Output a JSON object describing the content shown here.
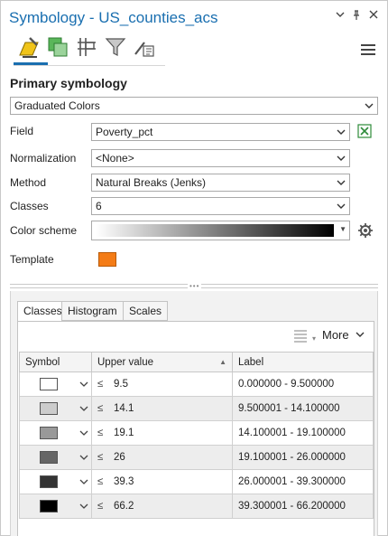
{
  "window": {
    "title": "Symbology - US_counties_acs",
    "controls": [
      "▾",
      "ᵖ",
      "×"
    ]
  },
  "toolbar": {
    "icons": [
      "primary-symbology-icon",
      "vary-symbology-icon",
      "symbol-layers-icon",
      "filter-icon",
      "label-classes-icon"
    ],
    "active_color": "#1a6fb0"
  },
  "primary": {
    "heading": "Primary symbology",
    "method_type": "Graduated Colors"
  },
  "fields": {
    "field_label": "Field",
    "field_value": "Poverty_pct",
    "normalization_label": "Normalization",
    "normalization_value": "<None>",
    "method_label": "Method",
    "method_value": "Natural Breaks (Jenks)",
    "classes_label": "Classes",
    "classes_value": "6",
    "color_scheme_label": "Color scheme",
    "color_scheme_start": "#ffffff",
    "color_scheme_end": "#000000",
    "template_label": "Template",
    "template_color": "#f47c16"
  },
  "tabs": [
    "Classes",
    "Histogram",
    "Scales"
  ],
  "classes_panel": {
    "more_label": "More",
    "columns": {
      "symbol": "Symbol",
      "upper": "Upper value",
      "label": "Label"
    },
    "rows": [
      {
        "color": "#ffffff",
        "op": "≤",
        "upper": "9.5",
        "label": "0.000000 - 9.500000"
      },
      {
        "color": "#cccccc",
        "op": "≤",
        "upper": "14.1",
        "label": "9.500001 - 14.100000"
      },
      {
        "color": "#999999",
        "op": "≤",
        "upper": "19.1",
        "label": "14.100001 - 19.100000"
      },
      {
        "color": "#666666",
        "op": "≤",
        "upper": "26",
        "label": "19.100001 - 26.000000"
      },
      {
        "color": "#333333",
        "op": "≤",
        "upper": "39.3",
        "label": "26.000001 - 39.300000"
      },
      {
        "color": "#000000",
        "op": "≤",
        "upper": "66.2",
        "label": "39.300001 - 66.200000"
      }
    ]
  }
}
